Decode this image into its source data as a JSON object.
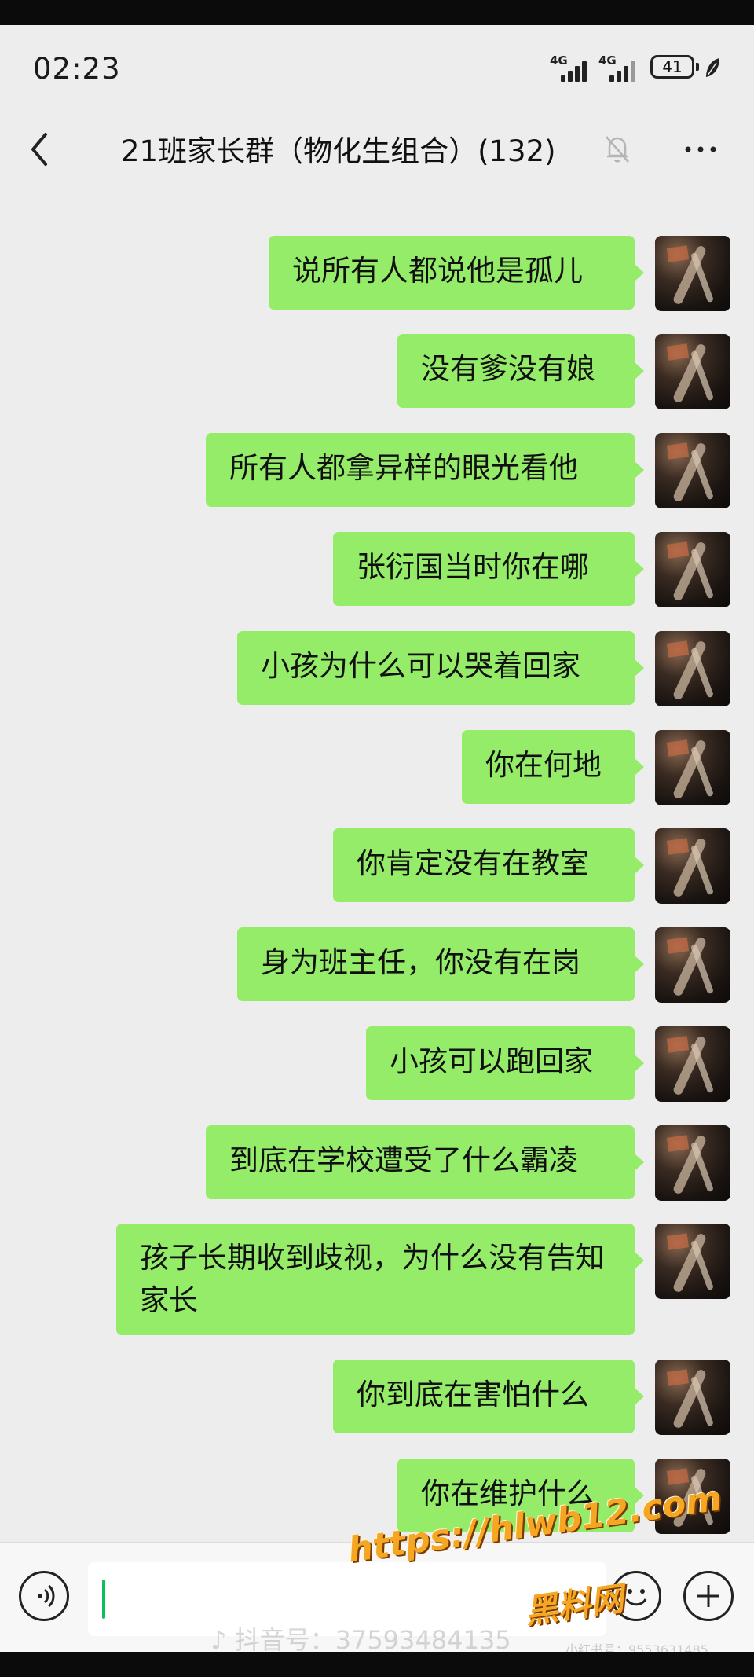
{
  "status_bar": {
    "time": "02:23",
    "signal_1": "4G",
    "signal_2": "4G",
    "battery": "41"
  },
  "header": {
    "title": "21班家长群（物化生组合）(132)",
    "back_icon": "chevron-left-icon",
    "mute_icon": "bell-off-icon",
    "more_icon": "more-dots-icon"
  },
  "colors": {
    "bubble": "#95ec69",
    "background": "#ededed",
    "accent": "#07c160"
  },
  "messages": [
    {
      "text": "说所有人都说他是孤儿"
    },
    {
      "text": "没有爹没有娘"
    },
    {
      "text": "所有人都拿异样的眼光看他"
    },
    {
      "text": "张衍国当时你在哪"
    },
    {
      "text": "小孩为什么可以哭着回家"
    },
    {
      "text": "你在何地"
    },
    {
      "text": "你肯定没有在教室"
    },
    {
      "text": "身为班主任，你没有在岗"
    },
    {
      "text": "小孩可以跑回家"
    },
    {
      "text": "到底在学校遭受了什么霸凌"
    },
    {
      "text": "孩子长期收到歧视，为什么没有告知家长"
    },
    {
      "text": "你到底在害怕什么"
    },
    {
      "text": "你在维护什么"
    }
  ],
  "input_bar": {
    "voice_icon": "voice-icon",
    "emoji_icon": "emoji-icon",
    "plus_icon": "plus-icon",
    "value": ""
  },
  "watermarks": {
    "tiktok": "♪ 抖音号：37593484135",
    "tiktok_small": "小红书号：9553631485",
    "site_url": "https://hlwb12.com",
    "site_name": "黑料网"
  }
}
